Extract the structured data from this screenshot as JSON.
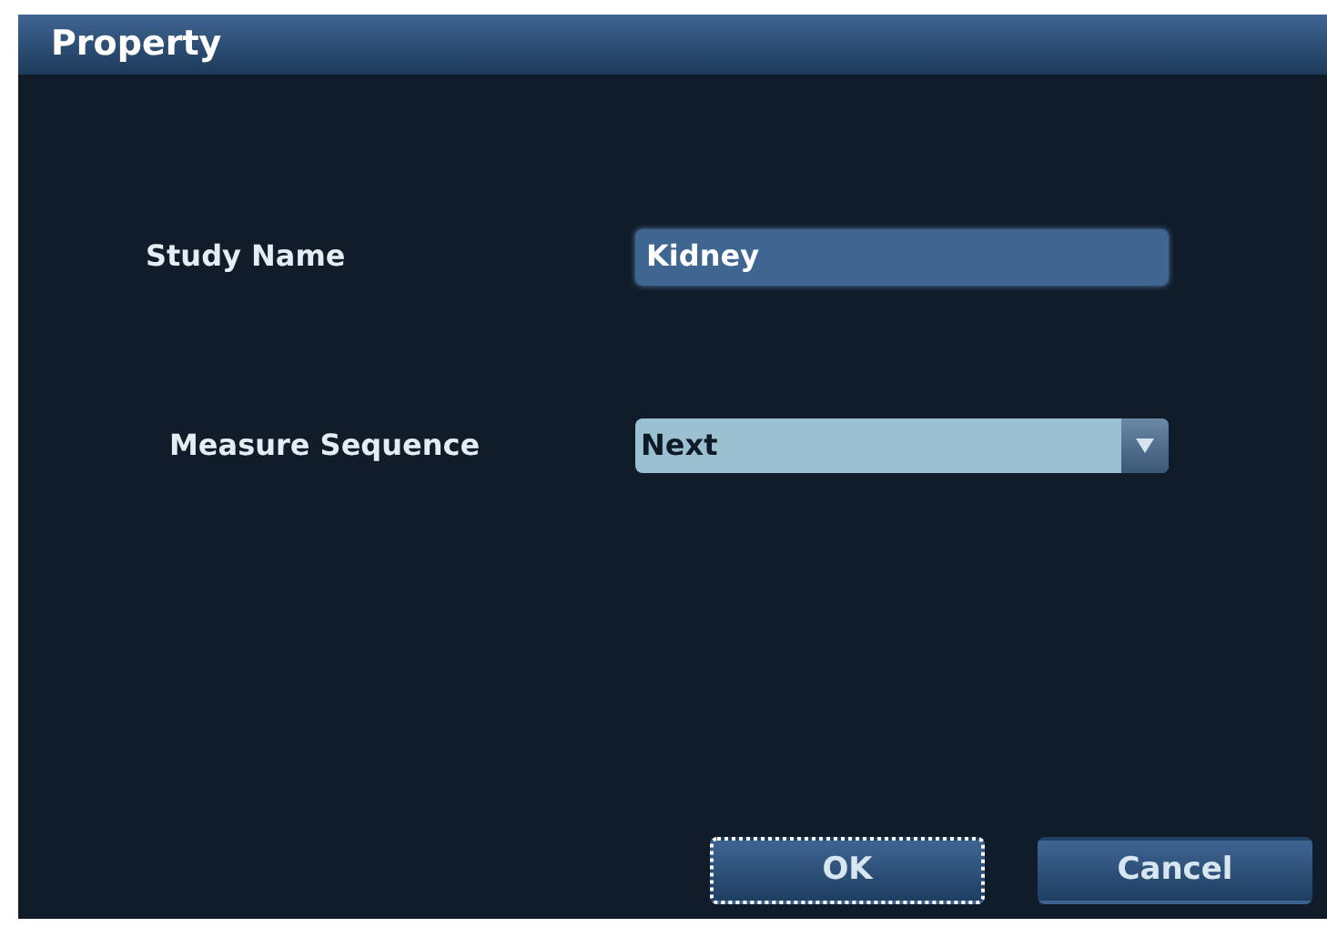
{
  "window": {
    "title": "Property"
  },
  "fields": [
    {
      "kind": "text",
      "label": "Study Name",
      "value": "Kidney"
    },
    {
      "kind": "dropdown",
      "label": "Measure Sequence",
      "value": "Next"
    }
  ],
  "buttons": [
    {
      "label": "OK",
      "focused": true
    },
    {
      "label": "Cancel",
      "focused": false
    }
  ]
}
